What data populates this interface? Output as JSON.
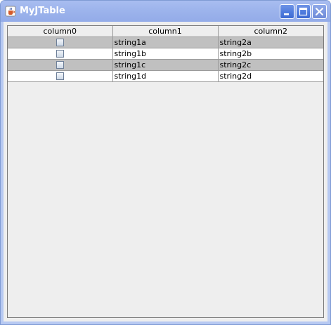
{
  "window": {
    "title": "MyJTable",
    "icon": "java-cup-icon",
    "controls": {
      "minimize_icon": "minimize-icon",
      "maximize_icon": "maximize-icon",
      "close_icon": "close-icon"
    }
  },
  "table": {
    "columns": [
      "column0",
      "column1",
      "column2"
    ],
    "rows": [
      {
        "checked": false,
        "col1": "string1a",
        "col2": "string2a",
        "shade": "#c0c0c0"
      },
      {
        "checked": false,
        "col1": "string1b",
        "col2": "string2b",
        "shade": "#ffffff"
      },
      {
        "checked": false,
        "col1": "string1c",
        "col2": "string2c",
        "shade": "#c0c0c0"
      },
      {
        "checked": false,
        "col1": "string1d",
        "col2": "string2d",
        "shade": "#ffffff"
      }
    ]
  },
  "colors": {
    "titlebar": "#9db4ec",
    "window_border": "#7f9bd4",
    "client_bg": "#eeeeee",
    "row_shaded": "#c0c0c0",
    "row_plain": "#ffffff"
  }
}
